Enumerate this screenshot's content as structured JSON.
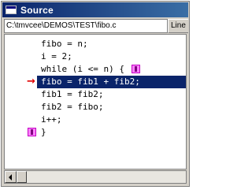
{
  "window": {
    "title": "Source",
    "file_path": "C:\\tmvcee\\DEMOS\\TEST\\fibo.c",
    "line_tab_label": "Line"
  },
  "editor": {
    "lines": [
      "fibo = n;",
      "i = 2;",
      "while (i <= n) {",
      "fibo = fib1 + fib2;",
      "fib1 = fib2;",
      "fib2 = fibo;",
      "i++;",
      "}"
    ],
    "current_line_index": 3
  },
  "colors": {
    "titlebar_start": "#0a246a",
    "titlebar_end": "#3a6ea5",
    "current_line_highlight": "#0a246a",
    "breakpoint_marker": "#ff80ff",
    "exec_arrow": "#e00000"
  },
  "icons": {
    "window_icon": "source-window-icon",
    "breakpoint": "breakpoint-marker-icon",
    "exec_pointer": "execution-arrow-icon",
    "scroll_left": "scroll-left-arrow-icon"
  }
}
